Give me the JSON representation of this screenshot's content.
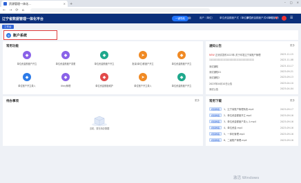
{
  "browser": {
    "tab_title": "资源管理一体化...",
    "tab_close": "×",
    "tab_new": "+",
    "window_controls": [
      "–",
      "□",
      "×"
    ],
    "nav_buttons": [
      "←",
      "→",
      "⟳",
      "⌂"
    ]
  },
  "header": {
    "app_title": "辽宁省数据管理一体化平台",
    "active_pill": "一键导航",
    "mail_icon": "✉",
    "user_label": "用户（单位）",
    "org_label_1": "单位资金额度户式（单位部门）",
    "org_label_2": "单位资金额度户式（单位部门）",
    "year": "2023年",
    "bell_icon": "♥",
    "menu_icon": "☰"
  },
  "subtab": {
    "label": "工作台"
  },
  "account": {
    "label": "账户系统",
    "icon": "◎"
  },
  "common_functions": {
    "title": "常用功能",
    "items": [
      {
        "label": "单位资金额度户开立",
        "color": "#8a62e8",
        "icon": "◆"
      },
      {
        "label": "单位资金额度户变更",
        "color": "#8a62e8",
        "icon": "◆"
      },
      {
        "label": "单位资金额度户开立",
        "color": "#1fa88c",
        "icon": "◆"
      },
      {
        "label": "批量(单位)额度户开立",
        "color": "#f08a24",
        "icon": "➤"
      },
      {
        "label": "单位资金额度户开立",
        "color": "#f08a24",
        "icon": "◆"
      },
      {
        "label": "单位账户开立录入",
        "color": "#2d7be8",
        "icon": "◆"
      },
      {
        "label": "Ukey管理",
        "color": "#8a62e8",
        "icon": "◆"
      },
      {
        "label": "单位资金额度维护",
        "color": "#e24a4a",
        "icon": "◆"
      },
      {
        "label": "单位账户开立录入",
        "color": "#f08a24",
        "icon": "➤"
      },
      {
        "label": "单位资金额度户开立",
        "color": "#1fa88c",
        "icon": "◆"
      }
    ]
  },
  "todo": {
    "title": "待办事项",
    "more": "更多",
    "empty_text": "当前，暂无待办数据"
  },
  "notices": {
    "title": "通知公告",
    "more": "更多",
    "rows": [
      {
        "badge": "NEW",
        "title": "正测试发布2023年-关于印发辽宁省账户管理",
        "date": "2023-11-15"
      },
      {
        "badge": "",
        "title": "1111111111111111111111111111111",
        "date": "2023-11-08"
      },
      {
        "badge": "",
        "title": "测试通知",
        "date": "2023-10-17"
      },
      {
        "badge": "",
        "title": "测试通知01",
        "date": "2023-09-21"
      },
      {
        "badge": "",
        "title": "测试通知2",
        "date": "2023-09-13"
      },
      {
        "badge": "",
        "title": "2023年04月10日公告",
        "date": "2023-04-10"
      },
      {
        "badge": "",
        "title": "测试公告",
        "date": "2023-04-04"
      }
    ]
  },
  "downloads": {
    "title": "常用下载",
    "more": "更多",
    "rows": [
      {
        "tag": "视频教程",
        "name": "1、辽宁省账户管理系统.mp4",
        "date": "2023-09-17"
      },
      {
        "tag": "视频教程",
        "name": "2、单位资金额度开立.mp4",
        "date": "2023-09-16"
      },
      {
        "tag": "视频教程",
        "name": "3、单位资金额度户录入-1.mp4",
        "date": "2023-09-16"
      },
      {
        "tag": "视频教程",
        "name": "4、单位资金.mp4",
        "date": "2023-09-16"
      },
      {
        "tag": "视频教程",
        "name": "5、一体化管理.mp4",
        "date": "2023-09-16"
      },
      {
        "tag": "视频教程",
        "name": "6、二级账户管理.mp4",
        "date": "2023-09-16"
      }
    ]
  },
  "os": {
    "watermark": "激活 Windows"
  }
}
